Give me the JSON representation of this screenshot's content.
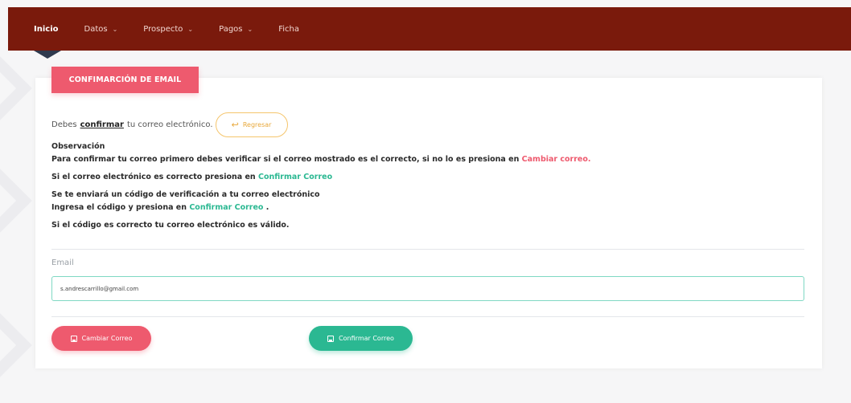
{
  "nav": {
    "items": [
      {
        "label": "Inicio",
        "active": true,
        "dropdown": false
      },
      {
        "label": "Datos",
        "active": false,
        "dropdown": true
      },
      {
        "label": "Prospecto",
        "active": false,
        "dropdown": true
      },
      {
        "label": "Pagos",
        "active": false,
        "dropdown": true
      },
      {
        "label": "Ficha",
        "active": false,
        "dropdown": false
      }
    ],
    "dropdown_glyph": "⌄"
  },
  "card": {
    "header": "CONFIMARCIÓN DE EMAIL",
    "intro_prefix": "Debes",
    "intro_strong": "confirmar",
    "intro_suffix": "tu correo electrónico.",
    "back_button": "Regresar",
    "back_icon": "reply-arrow-icon",
    "observation": {
      "title": "Observación",
      "line1_text": "Para confirmar tu correo primero debes verificar si el correo mostrado es el correcto, si no lo es presiona en",
      "line1_link": "Cambiar correo.",
      "line2_text": "Si el correo electrónico es correcto presiona en",
      "line2_link": "Confirmar Correo",
      "line3_text": "Se te enviará un código de verificación a tu correo electrónico",
      "line4_text": "Ingresa el código y presiona en",
      "line4_link": "Confirmar Correo",
      "line4_end": ".",
      "line5_text": "Si el código es correcto tu correo electrónico es válido."
    },
    "email_label": "Email",
    "email_value": "s.andrescarrillo@gmail.com",
    "change_button": "Cambiar Correo",
    "confirm_button": "Confirmar Correo"
  },
  "colors": {
    "navbar": "#7a1a0c",
    "accent_pink": "#ee5a6e",
    "accent_green": "#2bb892",
    "accent_orange": "#f5c56c"
  }
}
